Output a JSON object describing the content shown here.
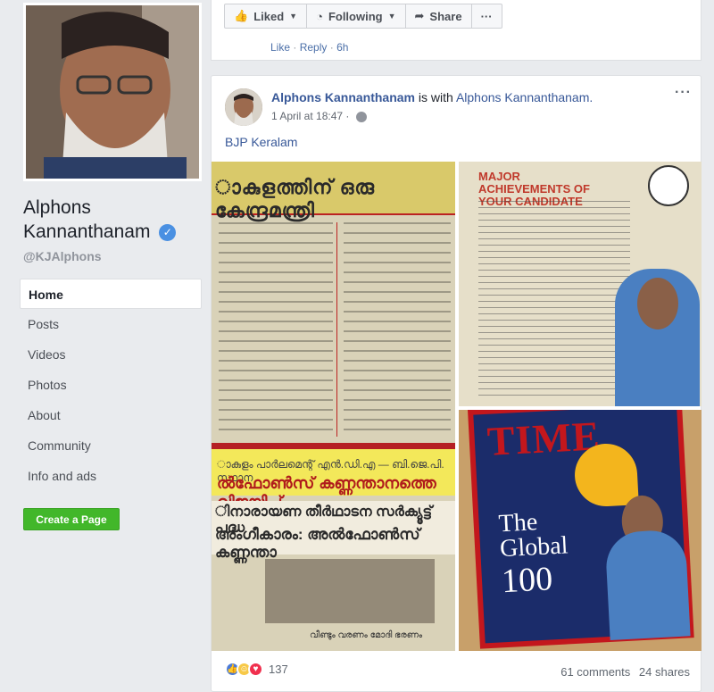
{
  "sidebar": {
    "page_name": "Alphons Kannanthanam",
    "handle": "@KJAlphons",
    "items": [
      {
        "label": "Home"
      },
      {
        "label": "Posts"
      },
      {
        "label": "Videos"
      },
      {
        "label": "Photos"
      },
      {
        "label": "About"
      },
      {
        "label": "Community"
      },
      {
        "label": "Info and ads"
      }
    ],
    "create_page_label": "Create a Page"
  },
  "top_actions": {
    "liked_label": "Liked",
    "following_label": "Following",
    "share_label": "Share",
    "more_label": "···",
    "comment_like": "Like",
    "comment_reply": "Reply",
    "comment_time": "6h"
  },
  "post": {
    "author": "Alphons Kannanthanam",
    "with_text": "is with",
    "tagged": "Alphons Kannanthanam.",
    "timestamp": "1 April at 18:47 ·",
    "more": "···",
    "text": "BJP Keralam",
    "images": {
      "newspaper_headline": "ാകുളത്തിന് ഒരു കേന്ദ്രമന്ത്രി",
      "newspaper_banner_top": "ാകുളം പാർലമെന്റ് എൻ.ഡി.എ — ബി.ജെ.പി. സ്ഥാന",
      "newspaper_banner_name": "ൽഫോൺസ് കണ്ണന്താനത്തെ വിജയിപ്",
      "newspaper_sub1": "ിനാരായണ തീർഥാടന സർക്യൂട്ട് പദ്ധ",
      "newspaper_sub2": "അംഗീകാരം: അൽഫോൺസ് കണ്ണന്താ",
      "newspaper_caption": "വീണ്ടും വരണം മോദി ഭരണം",
      "achievements_title": "MAJOR ACHIEVEMENTS OF YOUR CANDIDATE",
      "time_logo": "TIME",
      "time_line1": "The",
      "time_line2": "Global",
      "time_line3": "100"
    },
    "reaction_count": "137",
    "comments": "61 comments",
    "shares": "24 shares"
  },
  "colors": {
    "link": "#385898",
    "create_button": "#42b72a",
    "verified": "#4a90e2"
  }
}
